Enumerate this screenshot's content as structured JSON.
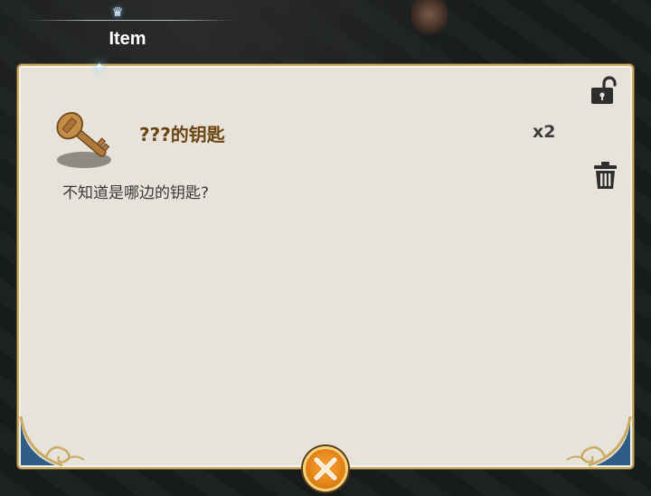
{
  "tab": {
    "title": "Item"
  },
  "item": {
    "name": "???的钥匙",
    "count": "x2",
    "description": "不知道是哪边的钥匙?",
    "icon": "key-icon"
  },
  "actions": {
    "lock_icon": "unlock-icon",
    "delete_icon": "trash-icon",
    "close_icon": "close-icon"
  },
  "colors": {
    "panel_bg": "#e7e3db",
    "panel_border": "#c9ab63",
    "item_name": "#6b4612",
    "close_button": "#e8871a"
  }
}
